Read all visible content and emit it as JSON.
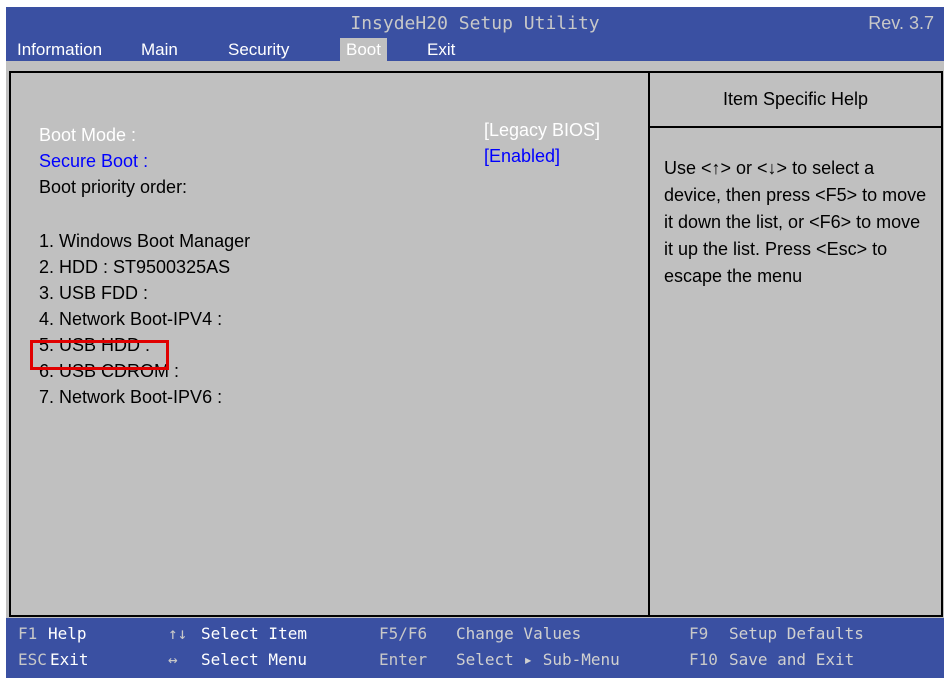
{
  "header": {
    "title": "InsydeH20 Setup Utility",
    "rev": "Rev.  3.7"
  },
  "tabs": [
    {
      "label": "Information"
    },
    {
      "label": "Main"
    },
    {
      "label": "Security"
    },
    {
      "label": "Boot",
      "active": true
    },
    {
      "label": "Exit"
    }
  ],
  "settings": {
    "boot_mode_label": "Boot Mode :",
    "boot_mode_value": "[Legacy BIOS]",
    "secure_boot_label": "Secure Boot :",
    "secure_boot_value": "[Enabled]",
    "priority_heading": "Boot priority order:"
  },
  "boot_items": [
    "1. Windows Boot Manager",
    "2. HDD : ST9500325AS",
    "3. USB FDD :",
    "4. Network Boot-IPV4 :",
    "5. USB HDD :",
    "6. USB CDROM :",
    "7.  Network Boot-IPV6 :"
  ],
  "help": {
    "title": "Item Specific Help",
    "text": "Use <↑> or <↓> to select a device, then press <F5> to move it down the list, or <F6> to move it up the list. Press <Esc> to escape the menu"
  },
  "footer": {
    "f1_key": "F1",
    "f1_desc": "Help",
    "esc_key": "ESC",
    "esc_desc": "Exit",
    "updown_icon": "↑↓",
    "select_item": "Select  Item",
    "leftright_icon": "↔",
    "select_menu": "Select  Menu",
    "f5f6_key": "F5/F6",
    "f5f6_desc": "Change  Values",
    "enter_key": "Enter",
    "enter_desc": "Select  ▸  Sub-Menu",
    "f9_key": "F9",
    "f9_desc": "Setup  Defaults",
    "f10_key": "F10",
    "f10_desc": "Save  and  Exit"
  },
  "colors": {
    "bar_blue": "#3a50a2",
    "panel_gray": "#c0c0c0",
    "highlight_red": "#e00000",
    "secure_blue": "#0000ff"
  }
}
